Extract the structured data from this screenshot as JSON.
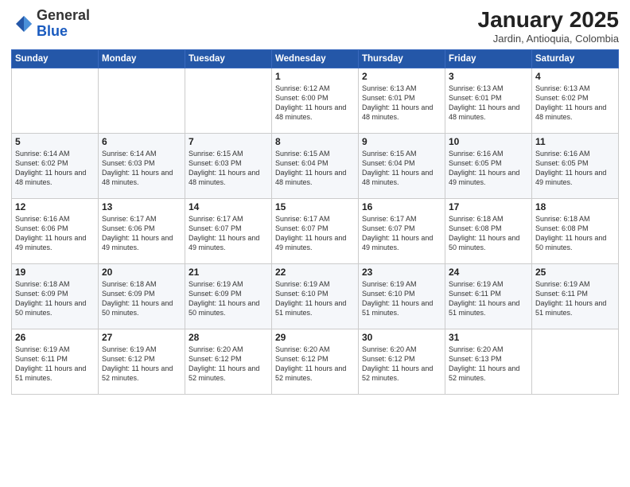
{
  "logo": {
    "general": "General",
    "blue": "Blue"
  },
  "title": "January 2025",
  "subtitle": "Jardin, Antioquia, Colombia",
  "days_of_week": [
    "Sunday",
    "Monday",
    "Tuesday",
    "Wednesday",
    "Thursday",
    "Friday",
    "Saturday"
  ],
  "weeks": [
    [
      {
        "day": "",
        "info": ""
      },
      {
        "day": "",
        "info": ""
      },
      {
        "day": "",
        "info": ""
      },
      {
        "day": "1",
        "info": "Sunrise: 6:12 AM\nSunset: 6:00 PM\nDaylight: 11 hours and 48 minutes."
      },
      {
        "day": "2",
        "info": "Sunrise: 6:13 AM\nSunset: 6:01 PM\nDaylight: 11 hours and 48 minutes."
      },
      {
        "day": "3",
        "info": "Sunrise: 6:13 AM\nSunset: 6:01 PM\nDaylight: 11 hours and 48 minutes."
      },
      {
        "day": "4",
        "info": "Sunrise: 6:13 AM\nSunset: 6:02 PM\nDaylight: 11 hours and 48 minutes."
      }
    ],
    [
      {
        "day": "5",
        "info": "Sunrise: 6:14 AM\nSunset: 6:02 PM\nDaylight: 11 hours and 48 minutes."
      },
      {
        "day": "6",
        "info": "Sunrise: 6:14 AM\nSunset: 6:03 PM\nDaylight: 11 hours and 48 minutes."
      },
      {
        "day": "7",
        "info": "Sunrise: 6:15 AM\nSunset: 6:03 PM\nDaylight: 11 hours and 48 minutes."
      },
      {
        "day": "8",
        "info": "Sunrise: 6:15 AM\nSunset: 6:04 PM\nDaylight: 11 hours and 48 minutes."
      },
      {
        "day": "9",
        "info": "Sunrise: 6:15 AM\nSunset: 6:04 PM\nDaylight: 11 hours and 48 minutes."
      },
      {
        "day": "10",
        "info": "Sunrise: 6:16 AM\nSunset: 6:05 PM\nDaylight: 11 hours and 49 minutes."
      },
      {
        "day": "11",
        "info": "Sunrise: 6:16 AM\nSunset: 6:05 PM\nDaylight: 11 hours and 49 minutes."
      }
    ],
    [
      {
        "day": "12",
        "info": "Sunrise: 6:16 AM\nSunset: 6:06 PM\nDaylight: 11 hours and 49 minutes."
      },
      {
        "day": "13",
        "info": "Sunrise: 6:17 AM\nSunset: 6:06 PM\nDaylight: 11 hours and 49 minutes."
      },
      {
        "day": "14",
        "info": "Sunrise: 6:17 AM\nSunset: 6:07 PM\nDaylight: 11 hours and 49 minutes."
      },
      {
        "day": "15",
        "info": "Sunrise: 6:17 AM\nSunset: 6:07 PM\nDaylight: 11 hours and 49 minutes."
      },
      {
        "day": "16",
        "info": "Sunrise: 6:17 AM\nSunset: 6:07 PM\nDaylight: 11 hours and 49 minutes."
      },
      {
        "day": "17",
        "info": "Sunrise: 6:18 AM\nSunset: 6:08 PM\nDaylight: 11 hours and 50 minutes."
      },
      {
        "day": "18",
        "info": "Sunrise: 6:18 AM\nSunset: 6:08 PM\nDaylight: 11 hours and 50 minutes."
      }
    ],
    [
      {
        "day": "19",
        "info": "Sunrise: 6:18 AM\nSunset: 6:09 PM\nDaylight: 11 hours and 50 minutes."
      },
      {
        "day": "20",
        "info": "Sunrise: 6:18 AM\nSunset: 6:09 PM\nDaylight: 11 hours and 50 minutes."
      },
      {
        "day": "21",
        "info": "Sunrise: 6:19 AM\nSunset: 6:09 PM\nDaylight: 11 hours and 50 minutes."
      },
      {
        "day": "22",
        "info": "Sunrise: 6:19 AM\nSunset: 6:10 PM\nDaylight: 11 hours and 51 minutes."
      },
      {
        "day": "23",
        "info": "Sunrise: 6:19 AM\nSunset: 6:10 PM\nDaylight: 11 hours and 51 minutes."
      },
      {
        "day": "24",
        "info": "Sunrise: 6:19 AM\nSunset: 6:11 PM\nDaylight: 11 hours and 51 minutes."
      },
      {
        "day": "25",
        "info": "Sunrise: 6:19 AM\nSunset: 6:11 PM\nDaylight: 11 hours and 51 minutes."
      }
    ],
    [
      {
        "day": "26",
        "info": "Sunrise: 6:19 AM\nSunset: 6:11 PM\nDaylight: 11 hours and 51 minutes."
      },
      {
        "day": "27",
        "info": "Sunrise: 6:19 AM\nSunset: 6:12 PM\nDaylight: 11 hours and 52 minutes."
      },
      {
        "day": "28",
        "info": "Sunrise: 6:20 AM\nSunset: 6:12 PM\nDaylight: 11 hours and 52 minutes."
      },
      {
        "day": "29",
        "info": "Sunrise: 6:20 AM\nSunset: 6:12 PM\nDaylight: 11 hours and 52 minutes."
      },
      {
        "day": "30",
        "info": "Sunrise: 6:20 AM\nSunset: 6:12 PM\nDaylight: 11 hours and 52 minutes."
      },
      {
        "day": "31",
        "info": "Sunrise: 6:20 AM\nSunset: 6:13 PM\nDaylight: 11 hours and 52 minutes."
      },
      {
        "day": "",
        "info": ""
      }
    ]
  ]
}
